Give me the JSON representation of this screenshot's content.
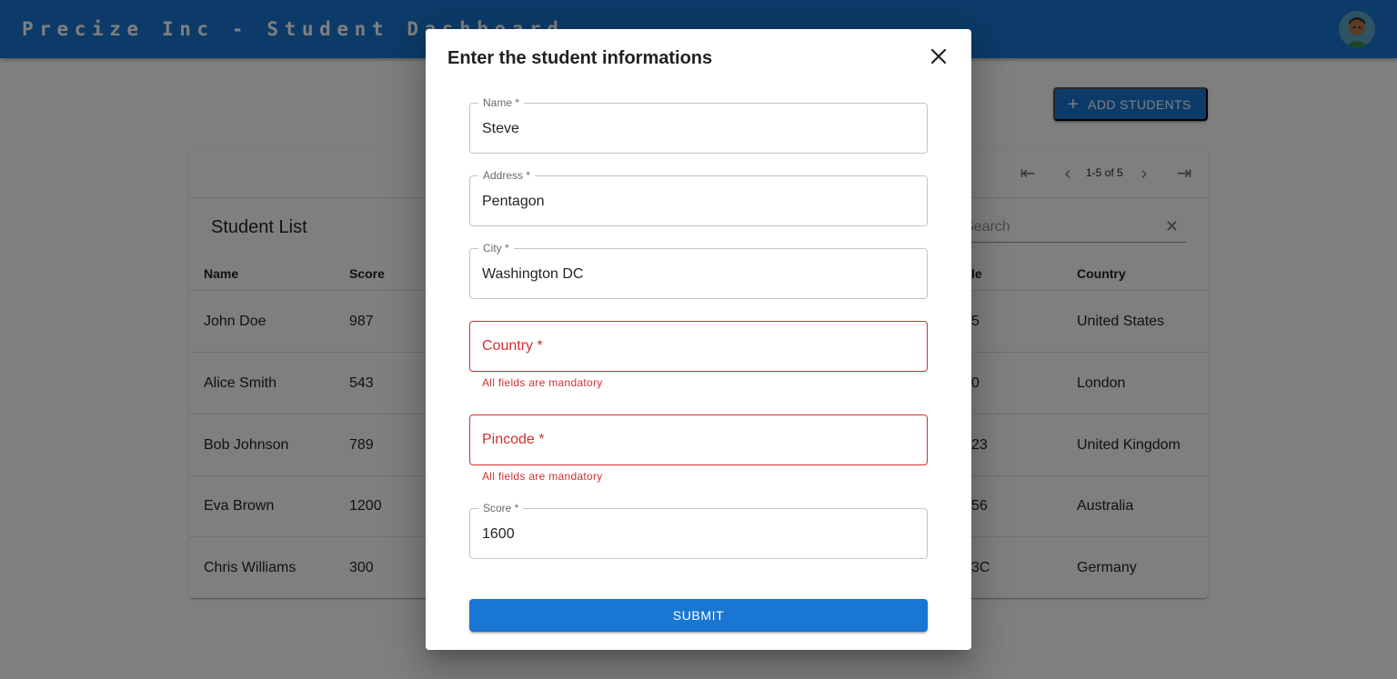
{
  "appbar": {
    "title": "Precize Inc - Student Dashboard",
    "avatar_icon": "user-avatar-icon"
  },
  "toolbar": {
    "add_label": "ADD STUDENTS"
  },
  "table": {
    "pagination_text": "1-5 of 5",
    "title": "Student List",
    "search_placeholder": "Search",
    "columns": [
      "Name",
      "Score",
      "Pincode",
      "Country"
    ],
    "rows": [
      {
        "name": "John Doe",
        "score": "987",
        "pincode_visible": "5",
        "country": "United States"
      },
      {
        "name": "Alice Smith",
        "score": "543",
        "pincode_visible": "0",
        "country": "London"
      },
      {
        "name": "Bob Johnson",
        "score": "789",
        "pincode_visible": "23",
        "country": "United Kingdom"
      },
      {
        "name": "Eva Brown",
        "score": "1200",
        "pincode_visible": "56",
        "country": "Australia"
      },
      {
        "name": "Chris Williams",
        "score": "300",
        "pincode_visible": "3C",
        "country": "Germany"
      }
    ],
    "pincode_header_visible": "le"
  },
  "dialog": {
    "title": "Enter the student informations",
    "fields": {
      "name": {
        "label": "Name *",
        "value": "Steve"
      },
      "address": {
        "label": "Address *",
        "value": "Pentagon"
      },
      "city": {
        "label": "City *",
        "value": "Washington DC"
      },
      "country": {
        "label": "Country *",
        "value": "",
        "error": "All fields are mandatory"
      },
      "pincode": {
        "label": "Pincode *",
        "value": "",
        "error": "All fields are mandatory"
      },
      "score": {
        "label": "Score *",
        "value": "1600"
      }
    },
    "submit_label": "SUBMIT"
  },
  "colors": {
    "primary": "#1976d2",
    "error": "#d32f2f"
  }
}
